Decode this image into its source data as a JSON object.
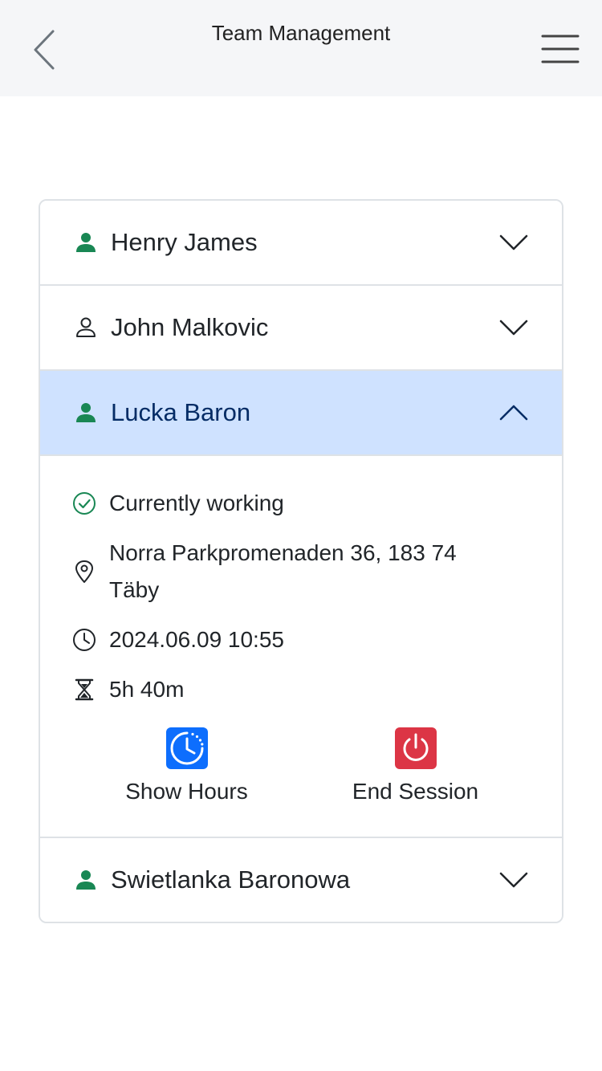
{
  "header": {
    "title": "Team Management"
  },
  "icons": {
    "back": "chevron-left-icon",
    "menu": "hamburger-menu-icon"
  },
  "colors": {
    "active_green": "#198754",
    "active_row_bg": "#cfe2ff",
    "active_text": "#052c65",
    "show_hours_blue": "#0d6efd",
    "end_session_red": "#dc3545"
  },
  "members": [
    {
      "name": "Henry James",
      "status": "active",
      "expanded": false
    },
    {
      "name": "John Malkovic",
      "status": "inactive",
      "expanded": false
    },
    {
      "name": "Lucka Baron",
      "status": "active",
      "expanded": true
    },
    {
      "name": "Swietlanka Baronowa",
      "status": "active",
      "expanded": false
    }
  ],
  "details": {
    "status": "Currently working",
    "address": "Norra Parkpromenaden 36, 183 74 Täby",
    "start_time": "2024.06.09 10:55",
    "duration": "5h 40m"
  },
  "actions": {
    "show_hours": "Show Hours",
    "end_session": "End Session"
  }
}
